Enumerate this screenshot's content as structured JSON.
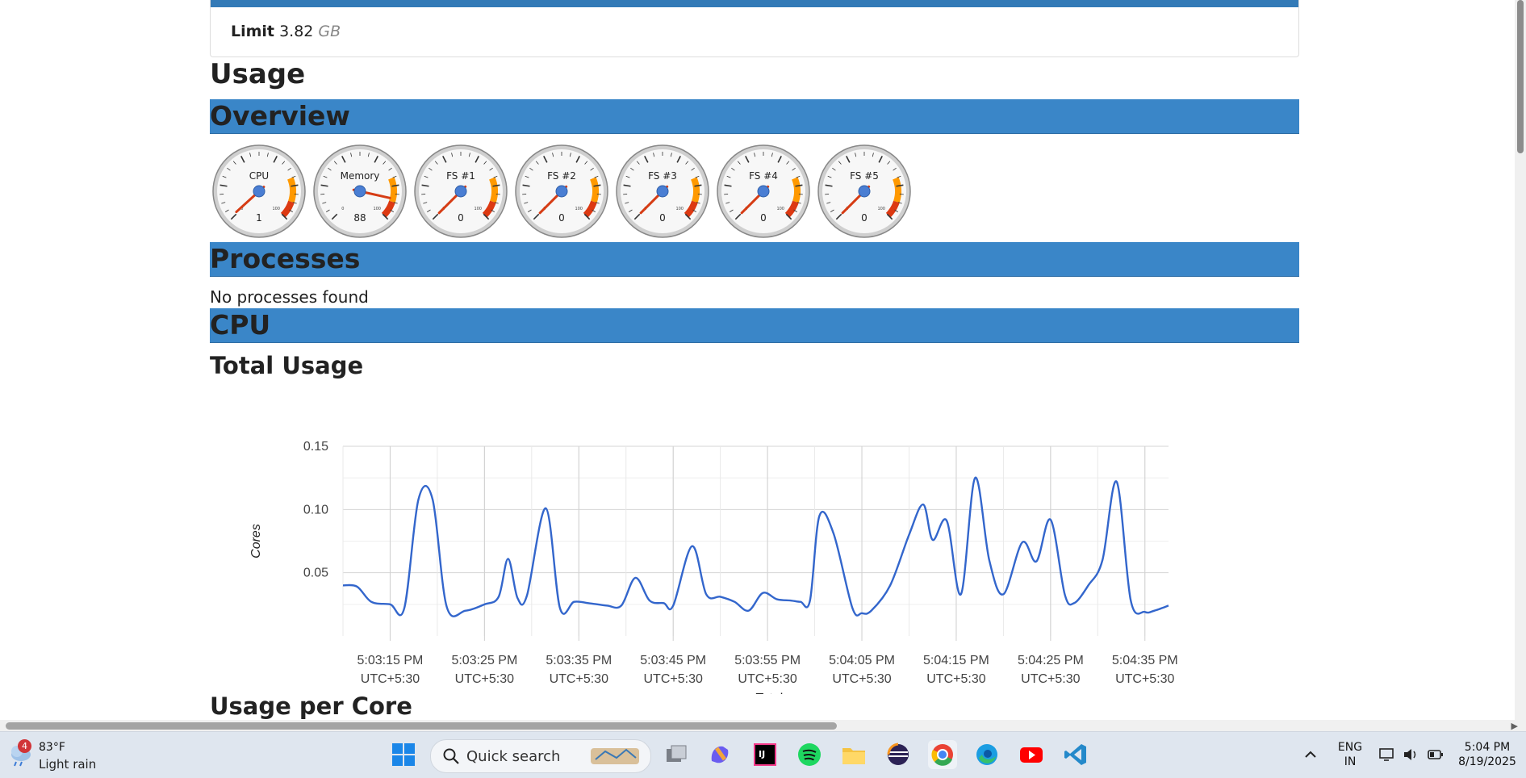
{
  "limit": {
    "label": "Limit",
    "value": "3.82",
    "unit": "GB"
  },
  "headings": {
    "usage": "Usage",
    "overview": "Overview",
    "processes": "Processes",
    "cpu": "CPU",
    "total_usage": "Total Usage",
    "usage_per_core": "Usage per Core"
  },
  "processes_note": "No processes found",
  "gauges": [
    {
      "label": "CPU",
      "value": 1
    },
    {
      "label": "Memory",
      "value": 88
    },
    {
      "label": "FS #1",
      "value": 0
    },
    {
      "label": "FS #2",
      "value": 0
    },
    {
      "label": "FS #3",
      "value": 0
    },
    {
      "label": "FS #4",
      "value": 0
    },
    {
      "label": "FS #5",
      "value": 0
    }
  ],
  "gauge_scale": {
    "min_label": "0",
    "max_label": "100"
  },
  "chart_data": {
    "type": "line",
    "title": "",
    "ylabel": "Cores",
    "xlabel": "",
    "ylim": [
      0.0,
      0.15
    ],
    "yticks": [
      0.05,
      0.1,
      0.15
    ],
    "ytick_labels": [
      "0.05",
      "0.10",
      "0.15"
    ],
    "xticks": [
      {
        "t": 5,
        "l1": "5:03:15 PM",
        "l2": "UTC+5:30"
      },
      {
        "t": 15,
        "l1": "5:03:25 PM",
        "l2": "UTC+5:30"
      },
      {
        "t": 25,
        "l1": "5:03:35 PM",
        "l2": "UTC+5:30"
      },
      {
        "t": 35,
        "l1": "5:03:45 PM",
        "l2": "UTC+5:30"
      },
      {
        "t": 45,
        "l1": "5:03:55 PM",
        "l2": "UTC+5:30"
      },
      {
        "t": 55,
        "l1": "5:04:05 PM",
        "l2": "UTC+5:30"
      },
      {
        "t": 65,
        "l1": "5:04:15 PM",
        "l2": "UTC+5:30"
      },
      {
        "t": 75,
        "l1": "5:04:25 PM",
        "l2": "UTC+5:30"
      },
      {
        "t": 85,
        "l1": "5:04:35 PM",
        "l2": "UTC+5:30"
      }
    ],
    "x_start": "5:03:10 PM",
    "legend": "bottom",
    "grid": true,
    "series": [
      {
        "name": "Total",
        "color": "#3366cc",
        "points": [
          [
            0,
            0.04
          ],
          [
            1.5,
            0.039
          ],
          [
            3,
            0.027
          ],
          [
            5,
            0.025
          ],
          [
            6.5,
            0.022
          ],
          [
            8,
            0.108
          ],
          [
            9.5,
            0.108
          ],
          [
            11,
            0.023
          ],
          [
            13,
            0.02
          ],
          [
            15,
            0.025
          ],
          [
            16.5,
            0.031
          ],
          [
            17.5,
            0.061
          ],
          [
            18.5,
            0.03
          ],
          [
            19.5,
            0.032
          ],
          [
            21.5,
            0.101
          ],
          [
            23,
            0.022
          ],
          [
            24.5,
            0.027
          ],
          [
            26,
            0.026
          ],
          [
            28,
            0.024
          ],
          [
            29.5,
            0.024
          ],
          [
            31,
            0.046
          ],
          [
            32.5,
            0.028
          ],
          [
            34,
            0.026
          ],
          [
            35,
            0.024
          ],
          [
            37,
            0.071
          ],
          [
            38.5,
            0.033
          ],
          [
            40,
            0.031
          ],
          [
            41.5,
            0.027
          ],
          [
            43,
            0.02
          ],
          [
            44.5,
            0.034
          ],
          [
            46,
            0.029
          ],
          [
            47.5,
            0.028
          ],
          [
            48.5,
            0.027
          ],
          [
            49.5,
            0.028
          ],
          [
            50.5,
            0.095
          ],
          [
            52,
            0.081
          ],
          [
            54,
            0.022
          ],
          [
            55,
            0.018
          ],
          [
            56,
            0.02
          ],
          [
            58,
            0.04
          ],
          [
            60,
            0.08
          ],
          [
            61.5,
            0.104
          ],
          [
            62.5,
            0.076
          ],
          [
            64,
            0.091
          ],
          [
            65.5,
            0.033
          ],
          [
            67,
            0.125
          ],
          [
            68.5,
            0.06
          ],
          [
            70,
            0.033
          ],
          [
            72,
            0.074
          ],
          [
            73.5,
            0.059
          ],
          [
            75,
            0.092
          ],
          [
            76.5,
            0.033
          ],
          [
            77.5,
            0.026
          ],
          [
            79,
            0.04
          ],
          [
            80.5,
            0.06
          ],
          [
            82,
            0.122
          ],
          [
            83.5,
            0.028
          ],
          [
            85,
            0.019
          ],
          [
            86,
            0.02
          ],
          [
            87.5,
            0.024
          ]
        ]
      }
    ]
  },
  "taskbar": {
    "weather_temp": "83°F",
    "weather_condition": "Light rain",
    "weather_badge": "4",
    "search_placeholder": "Quick search",
    "lang_line1": "ENG",
    "lang_line2": "IN",
    "time": "5:04 PM",
    "date": "8/19/2025"
  },
  "colors": {
    "section": "#3a86c8",
    "series": "#3366cc",
    "needle": "#d63c14"
  }
}
